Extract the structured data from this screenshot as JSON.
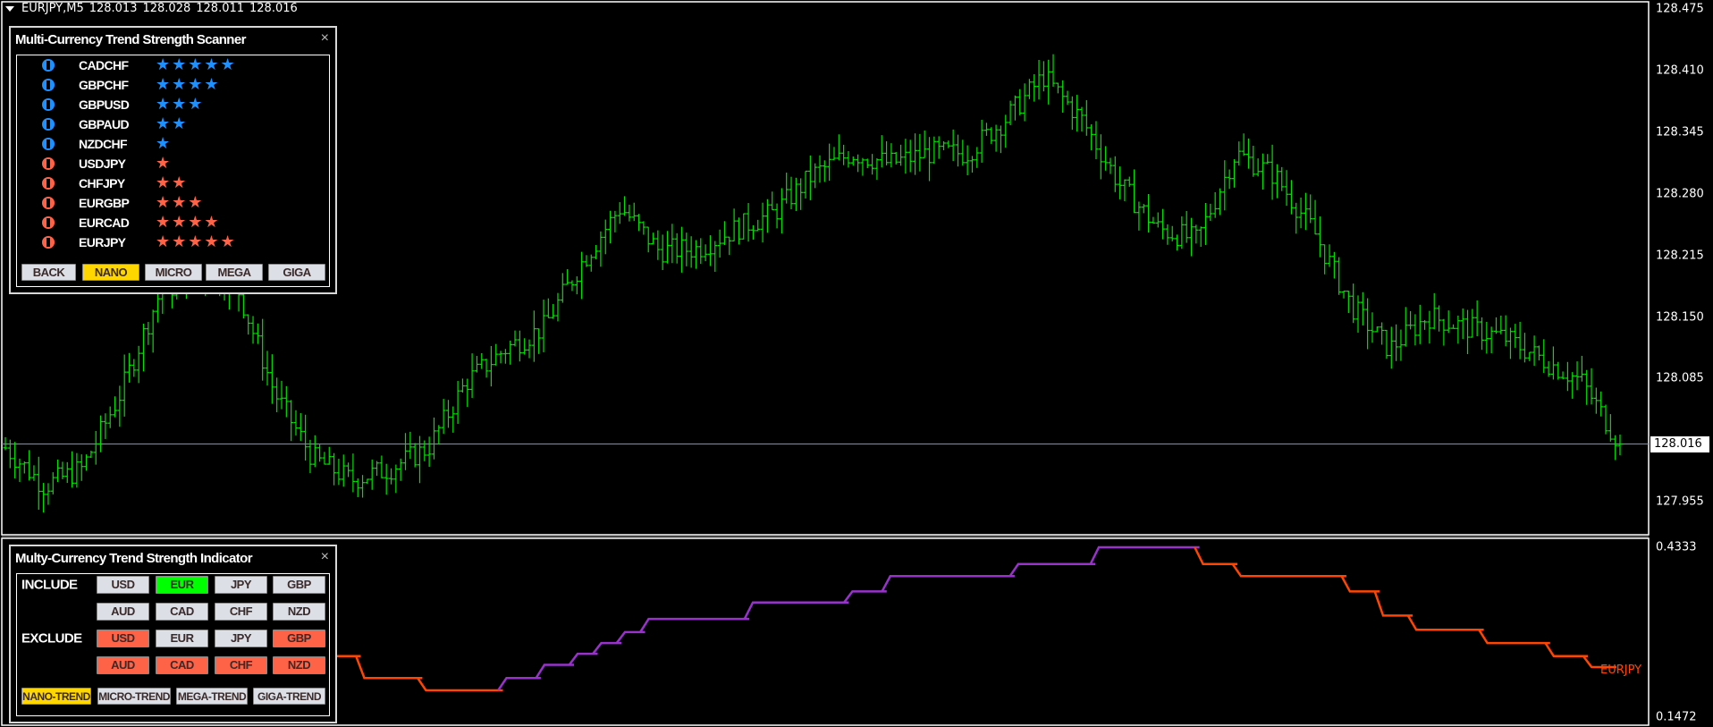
{
  "header": {
    "symbol": "EURJPY,M5",
    "open": "128.013",
    "high": "128.028",
    "low": "128.011",
    "close": "128.016"
  },
  "price_axis": {
    "ticks": [
      "128.475",
      "128.410",
      "128.345",
      "128.280",
      "128.215",
      "128.150",
      "128.085",
      "127.955"
    ],
    "current_price": "128.016"
  },
  "indicator_axis": {
    "max": "0.4333",
    "min": "0.1472",
    "series_label": "EURJPY"
  },
  "colors": {
    "bull": "#1e90ff",
    "bear": "#ff6347",
    "bars": "#00e000",
    "active_include": "#00ff00",
    "active_trend": "#ffd700",
    "button": "#dcdfe6",
    "line_up": "#9932cc",
    "line_down": "#ff4500"
  },
  "price_path": [
    128.012,
    127.972,
    127.99,
    128.07,
    128.174,
    128.197,
    128.185,
    128.07,
    128.001,
    127.978,
    127.99,
    128.012,
    128.082,
    128.116,
    128.139,
    128.208,
    128.266,
    128.22,
    128.222,
    128.243,
    128.26,
    128.3,
    128.323,
    128.312,
    128.323,
    128.323,
    128.358,
    128.404,
    128.358,
    128.289,
    128.243,
    128.231,
    128.323,
    128.3,
    128.243,
    128.162,
    128.116,
    128.151,
    128.139,
    128.128,
    128.105,
    128.082,
    128.016
  ],
  "indicator_steps": [
    {
      "value": 0.25,
      "bars": 5,
      "trend": "down"
    },
    {
      "value": 0.2131,
      "bars": 13,
      "trend": "down"
    },
    {
      "value": 0.1924,
      "bars": 17,
      "trend": "down"
    },
    {
      "value": 0.2131,
      "bars": 8,
      "trend": "up"
    },
    {
      "value": 0.2352,
      "bars": 7,
      "trend": "up"
    },
    {
      "value": 0.254,
      "bars": 5,
      "trend": "up"
    },
    {
      "value": 0.272,
      "bars": 5,
      "trend": "up"
    },
    {
      "value": 0.2905,
      "bars": 5,
      "trend": "up"
    },
    {
      "value": 0.3127,
      "bars": 22,
      "trend": "up"
    },
    {
      "value": 0.3404,
      "bars": 21,
      "trend": "up"
    },
    {
      "value": 0.3589,
      "bars": 8,
      "trend": "up"
    },
    {
      "value": 0.3847,
      "bars": 27,
      "trend": "up"
    },
    {
      "value": 0.405,
      "bars": 17,
      "trend": "up"
    },
    {
      "value": 0.4333,
      "bars": 22,
      "trend": "up"
    },
    {
      "value": 0.405,
      "bars": 8,
      "trend": "down"
    },
    {
      "value": 0.3847,
      "bars": 23,
      "trend": "down"
    },
    {
      "value": 0.3589,
      "bars": 7,
      "trend": "down"
    },
    {
      "value": 0.3183,
      "bars": 7,
      "trend": "down"
    },
    {
      "value": 0.2943,
      "bars": 15,
      "trend": "down"
    },
    {
      "value": 0.272,
      "bars": 14,
      "trend": "down"
    },
    {
      "value": 0.25,
      "bars": 8,
      "trend": "down"
    },
    {
      "value": 0.2315,
      "bars": 6,
      "trend": "down"
    }
  ],
  "scanner": {
    "title": "Multi-Currency Trend Strength Scanner",
    "close": "×",
    "rows": [
      {
        "pair": "CADCHF",
        "direction": "up",
        "stars": "★★★★★"
      },
      {
        "pair": "GBPCHF",
        "direction": "up",
        "stars": "★★★★"
      },
      {
        "pair": "GBPUSD",
        "direction": "up",
        "stars": "★★★"
      },
      {
        "pair": "GBPAUD",
        "direction": "up",
        "stars": "★★"
      },
      {
        "pair": "NZDCHF",
        "direction": "up",
        "stars": "★"
      },
      {
        "pair": "USDJPY",
        "direction": "down",
        "stars": "★"
      },
      {
        "pair": "CHFJPY",
        "direction": "down",
        "stars": "★★"
      },
      {
        "pair": "EURGBP",
        "direction": "down",
        "stars": "★★★"
      },
      {
        "pair": "EURCAD",
        "direction": "down",
        "stars": "★★★★"
      },
      {
        "pair": "EURJPY",
        "direction": "down",
        "stars": "★★★★★"
      }
    ],
    "buttons": [
      {
        "label": "BACK",
        "active": false
      },
      {
        "label": "NANO",
        "active": true
      },
      {
        "label": "MICRO",
        "active": false
      },
      {
        "label": "MEGA",
        "active": false
      },
      {
        "label": "GIGA",
        "active": false
      }
    ]
  },
  "indicator": {
    "title": "Multy-Currency Trend Strength Indicator",
    "close": "×",
    "include_label": "INCLUDE",
    "exclude_label": "EXCLUDE",
    "include": [
      {
        "label": "USD",
        "state": "off"
      },
      {
        "label": "EUR",
        "state": "on"
      },
      {
        "label": "JPY",
        "state": "off"
      },
      {
        "label": "GBP",
        "state": "off"
      },
      {
        "label": "AUD",
        "state": "off"
      },
      {
        "label": "CAD",
        "state": "off"
      },
      {
        "label": "CHF",
        "state": "off"
      },
      {
        "label": "NZD",
        "state": "off"
      }
    ],
    "exclude": [
      {
        "label": "USD",
        "state": "on"
      },
      {
        "label": "EUR",
        "state": "off"
      },
      {
        "label": "JPY",
        "state": "off"
      },
      {
        "label": "GBP",
        "state": "on"
      },
      {
        "label": "AUD",
        "state": "on"
      },
      {
        "label": "CAD",
        "state": "on"
      },
      {
        "label": "CHF",
        "state": "on"
      },
      {
        "label": "NZD",
        "state": "on"
      }
    ],
    "trends": [
      {
        "label": "NANO-TREND",
        "active": true
      },
      {
        "label": "MICRO-TREND",
        "active": false
      },
      {
        "label": "MEGA-TREND",
        "active": false
      },
      {
        "label": "GIGA-TREND",
        "active": false
      }
    ]
  }
}
